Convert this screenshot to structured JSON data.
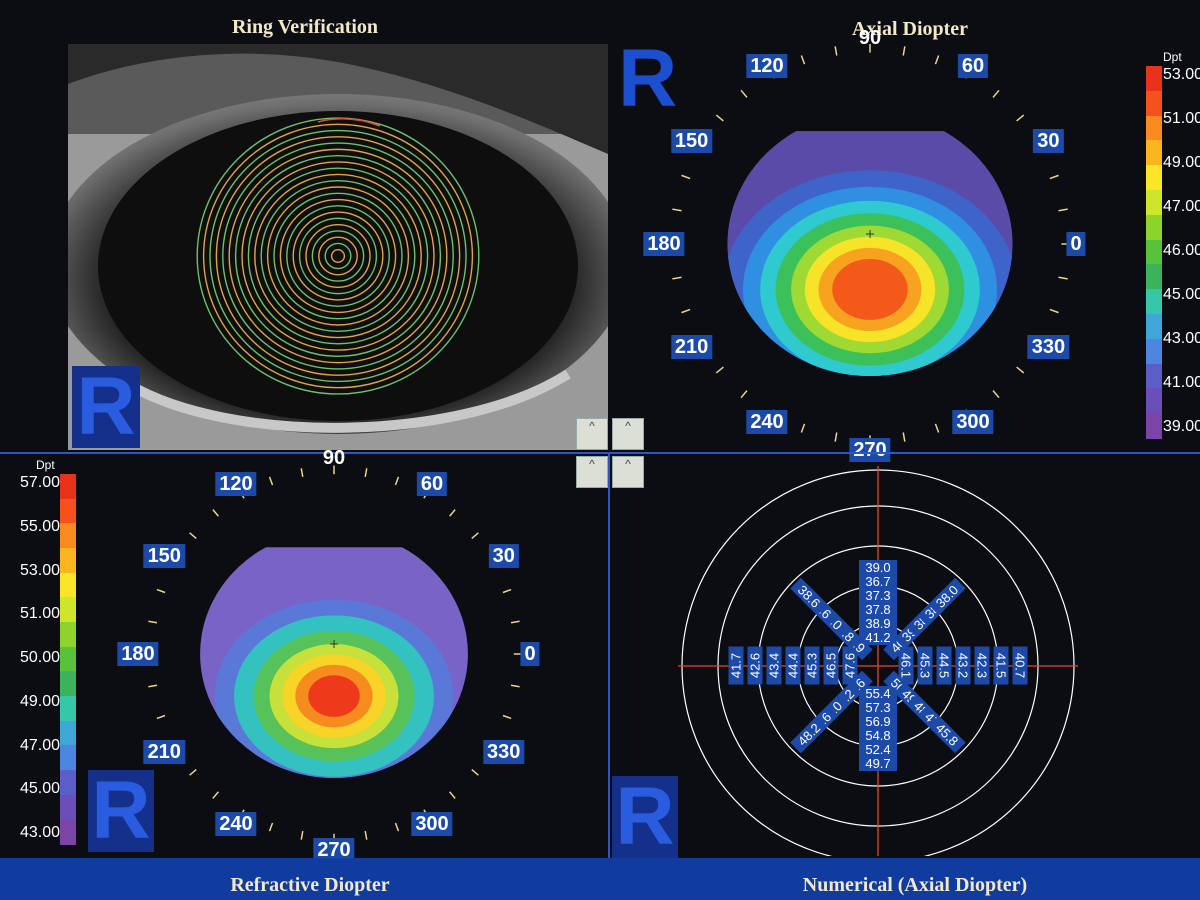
{
  "titles": {
    "ring": "Ring Verification",
    "axial": "Axial Diopter",
    "refractive": "Refractive Diopter",
    "numerical": "Numerical (Axial Diopter)"
  },
  "eye_label": "R",
  "axial_scale": {
    "unit": "Dpt",
    "labels": [
      "53.00",
      "51.00",
      "49.00",
      "47.00",
      "46.00",
      "45.00",
      "43.00",
      "41.00",
      "39.00"
    ],
    "colors": [
      "#e8321a",
      "#f4511c",
      "#f98a1f",
      "#fbb51f",
      "#fbe527",
      "#cfe52a",
      "#8ed22c",
      "#57c23a",
      "#3bb25c",
      "#36c7a8",
      "#3fa7d8",
      "#4c86e0",
      "#5a5fc8",
      "#6b4fb8",
      "#7b45a8"
    ]
  },
  "refractive_scale": {
    "unit": "Dpt",
    "labels": [
      "57.00",
      "55.00",
      "53.00",
      "51.00",
      "50.00",
      "49.00",
      "47.00",
      "45.00",
      "43.00"
    ],
    "colors": [
      "#e8321a",
      "#f4511c",
      "#f98a1f",
      "#fbb51f",
      "#fbe527",
      "#cfe52a",
      "#8ed22c",
      "#57c23a",
      "#3bb25c",
      "#36c7a8",
      "#3fa7d8",
      "#4c86e0",
      "#5a5fc8",
      "#6b4fb8",
      "#7b45a8"
    ]
  },
  "axial_angles": [
    "90",
    "60",
    "30",
    "0",
    "330",
    "300",
    "270",
    "240",
    "210",
    "180",
    "150",
    "120"
  ],
  "refractive_angles": [
    "90",
    "60",
    "30",
    "0",
    "330",
    "300",
    "270",
    "240",
    "210",
    "180",
    "150",
    "120"
  ],
  "numerical": {
    "up": [
      "39.0",
      "36.7",
      "37.3",
      "37.8",
      "38.9",
      "41.2"
    ],
    "down": [
      "55.4",
      "57.3",
      "56.9",
      "54.8",
      "52.4",
      "49.7"
    ],
    "left": [
      "41.7",
      "42.6",
      "43.4",
      "44.4",
      "45.3",
      "46.5",
      "47.6"
    ],
    "right": [
      "46.1",
      "45.3",
      "44.5",
      "43.2",
      "42.3",
      "41.5",
      "40.7"
    ],
    "upleft": [
      "38.6",
      "38.6",
      "39.0",
      "39.8",
      "40.9"
    ],
    "upright": [
      "38.0",
      "38.6",
      "38.4",
      "39.4",
      "40.4"
    ],
    "downleft": [
      "51.6",
      "51.2",
      "49.0",
      "49.6",
      "48.2"
    ],
    "downright": [
      "50.5",
      "49.8",
      "48.4",
      "47.0",
      "45.8"
    ]
  },
  "nav": {
    "up1": "^",
    "up2": "^",
    "up3": "^",
    "up4": "^"
  }
}
